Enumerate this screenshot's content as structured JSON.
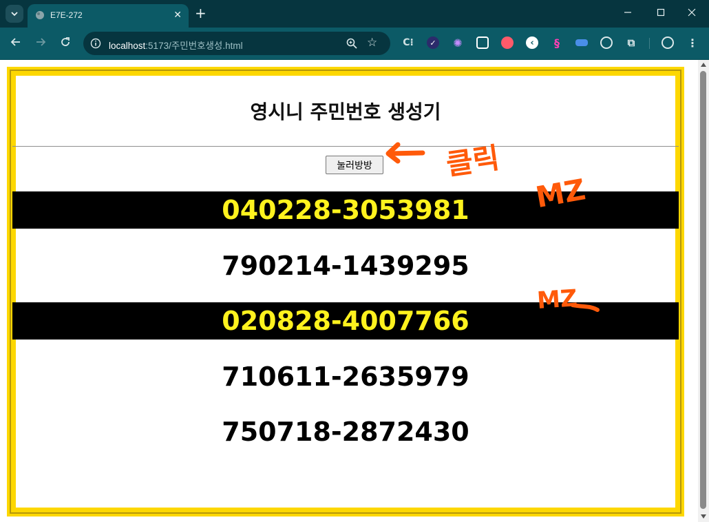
{
  "browser": {
    "tab_title": "E7E-272",
    "url_host": "localhost",
    "url_rest": ":5173/주민번호생성.html",
    "tab_close": "✕",
    "new_tab": "+",
    "extensions": [
      "ext-c",
      "ext-check",
      "ext-gear",
      "ext-square",
      "ext-bird",
      "ext-back",
      "ext-s",
      "ext-flag",
      "ext-target",
      "ext-puzzle"
    ]
  },
  "page": {
    "title": "영시니 주민번호 생성기",
    "button_label": "눌러방방",
    "numbers": [
      {
        "value": "040228-3053981",
        "highlight": true
      },
      {
        "value": "790214-1439295",
        "highlight": false
      },
      {
        "value": "020828-4007766",
        "highlight": true
      },
      {
        "value": "710611-2635979",
        "highlight": false
      },
      {
        "value": "750718-2872430",
        "highlight": false
      }
    ]
  },
  "annotations": {
    "click_note": "클릭",
    "mz_note_1": "MZ",
    "mz_note_2": "MZ",
    "ink_color": "#ff5a0a"
  },
  "colors": {
    "frame": "#fdd701",
    "highlight_bg": "#000000",
    "highlight_text": "#fff21e"
  }
}
